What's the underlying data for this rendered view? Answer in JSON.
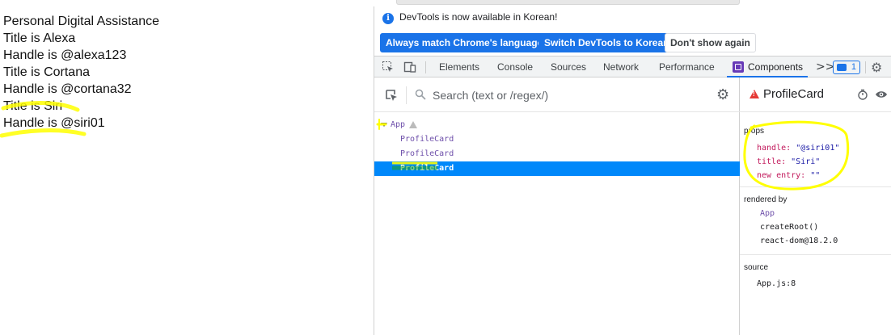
{
  "page": {
    "lines": [
      "Personal Digital Assistance",
      "Title is Alexa",
      "Handle is @alexa123",
      "Title is Cortana",
      "Handle is @cortana32",
      "Title is Siri",
      "Handle is @siri01"
    ]
  },
  "devtools": {
    "info_text": "DevTools is now available in Korean!",
    "buttons": {
      "match_language": "Always match Chrome's language",
      "switch_korean": "Switch DevTools to Korean",
      "dont_show": "Don't show again"
    },
    "tabs": [
      "Elements",
      "Console",
      "Sources",
      "Network",
      "Performance",
      "Components"
    ],
    "active_tab": "Components",
    "more_tabs": ">>",
    "messages_count": "1"
  },
  "components": {
    "search_placeholder": "Search (text or /regex/)",
    "tree": [
      {
        "name": "App"
      },
      {
        "name": "ProfileCard"
      },
      {
        "name": "ProfileCard"
      },
      {
        "name": "ProfileCard"
      }
    ]
  },
  "inspector": {
    "title": "ProfileCard",
    "props_label": "props",
    "props": [
      {
        "key": "handle:",
        "value": "\"@siri01\""
      },
      {
        "key": "title:",
        "value": "\"Siri\""
      },
      {
        "key": "new entry:",
        "value": "\"\""
      }
    ],
    "rendered_by_label": "rendered by",
    "rendered_by": [
      "App",
      "createRoot()",
      "react-dom@18.2.0"
    ],
    "source_label": "source",
    "source": "App.js:8"
  },
  "colors": {
    "accent": "#1a73e8",
    "selected_row": "#0088fa",
    "highlight": "#ffff00",
    "component_name": "#6e4faa",
    "prop_key": "#c2185b"
  },
  "icons": [
    "info-icon",
    "select-element-icon",
    "device-toggle-icon",
    "components-logo-icon",
    "messages-icon",
    "settings-gear-icon",
    "inspect-select-icon",
    "search-icon",
    "settings-icon",
    "warning-icon",
    "stopwatch-icon",
    "eye-icon"
  ]
}
